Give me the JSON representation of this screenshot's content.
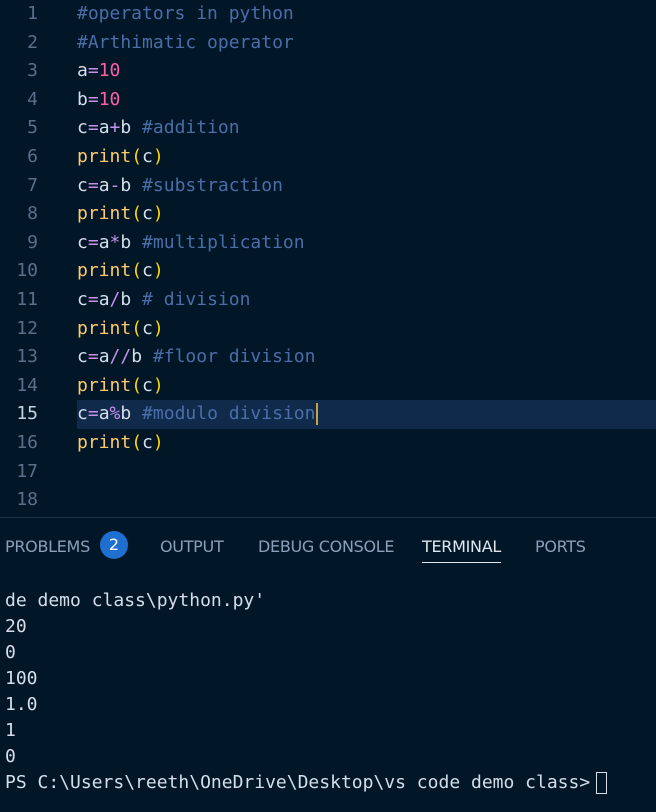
{
  "editor": {
    "lines": [
      {
        "num": "1",
        "tokens": [
          {
            "t": "#operators in python",
            "c": "comment"
          }
        ]
      },
      {
        "num": "2",
        "tokens": [
          {
            "t": "#Arthimatic operator",
            "c": "comment"
          }
        ]
      },
      {
        "num": "3",
        "tokens": [
          {
            "t": "a",
            "c": "var"
          },
          {
            "t": "=",
            "c": "op"
          },
          {
            "t": "10",
            "c": "num2"
          }
        ]
      },
      {
        "num": "4",
        "tokens": [
          {
            "t": "b",
            "c": "var"
          },
          {
            "t": "=",
            "c": "op"
          },
          {
            "t": "10",
            "c": "num2"
          }
        ]
      },
      {
        "num": "5",
        "tokens": [
          {
            "t": "c",
            "c": "var"
          },
          {
            "t": "=",
            "c": "op"
          },
          {
            "t": "a",
            "c": "var"
          },
          {
            "t": "+",
            "c": "op"
          },
          {
            "t": "b",
            "c": "var"
          },
          {
            "t": " #addition",
            "c": "comment"
          }
        ]
      },
      {
        "num": "6",
        "tokens": [
          {
            "t": "print",
            "c": "fn"
          },
          {
            "t": "(",
            "c": "paren"
          },
          {
            "t": "c",
            "c": "var"
          },
          {
            "t": ")",
            "c": "paren"
          }
        ]
      },
      {
        "num": "7",
        "tokens": [
          {
            "t": "c",
            "c": "var"
          },
          {
            "t": "=",
            "c": "op"
          },
          {
            "t": "a",
            "c": "var"
          },
          {
            "t": "-",
            "c": "op"
          },
          {
            "t": "b",
            "c": "var"
          },
          {
            "t": " #substraction",
            "c": "comment"
          }
        ]
      },
      {
        "num": "8",
        "tokens": [
          {
            "t": "print",
            "c": "fn"
          },
          {
            "t": "(",
            "c": "paren"
          },
          {
            "t": "c",
            "c": "var"
          },
          {
            "t": ")",
            "c": "paren"
          }
        ]
      },
      {
        "num": "9",
        "tokens": [
          {
            "t": "c",
            "c": "var"
          },
          {
            "t": "=",
            "c": "op"
          },
          {
            "t": "a",
            "c": "var"
          },
          {
            "t": "*",
            "c": "op"
          },
          {
            "t": "b",
            "c": "var"
          },
          {
            "t": " #multiplication",
            "c": "comment"
          }
        ]
      },
      {
        "num": "10",
        "tokens": [
          {
            "t": "print",
            "c": "fn"
          },
          {
            "t": "(",
            "c": "paren"
          },
          {
            "t": "c",
            "c": "var"
          },
          {
            "t": ")",
            "c": "paren"
          }
        ]
      },
      {
        "num": "11",
        "tokens": [
          {
            "t": "c",
            "c": "var"
          },
          {
            "t": "=",
            "c": "op"
          },
          {
            "t": "a",
            "c": "var"
          },
          {
            "t": "/",
            "c": "op"
          },
          {
            "t": "b",
            "c": "var"
          },
          {
            "t": " # division",
            "c": "comment"
          }
        ]
      },
      {
        "num": "12",
        "tokens": [
          {
            "t": "print",
            "c": "fn"
          },
          {
            "t": "(",
            "c": "paren"
          },
          {
            "t": "c",
            "c": "var"
          },
          {
            "t": ")",
            "c": "paren"
          }
        ]
      },
      {
        "num": "13",
        "tokens": [
          {
            "t": "c",
            "c": "var"
          },
          {
            "t": "=",
            "c": "op"
          },
          {
            "t": "a",
            "c": "var"
          },
          {
            "t": "//",
            "c": "op"
          },
          {
            "t": "b",
            "c": "var"
          },
          {
            "t": " #floor division",
            "c": "comment"
          }
        ]
      },
      {
        "num": "14",
        "tokens": [
          {
            "t": "print",
            "c": "fn"
          },
          {
            "t": "(",
            "c": "paren"
          },
          {
            "t": "c",
            "c": "var"
          },
          {
            "t": ")",
            "c": "paren"
          }
        ]
      },
      {
        "num": "15",
        "current": true,
        "tokens": [
          {
            "t": "c",
            "c": "var"
          },
          {
            "t": "=",
            "c": "op"
          },
          {
            "t": "a",
            "c": "var"
          },
          {
            "t": "%",
            "c": "op"
          },
          {
            "t": "b",
            "c": "var"
          },
          {
            "t": " #modulo division",
            "c": "comment"
          }
        ]
      },
      {
        "num": "16",
        "tokens": [
          {
            "t": "print",
            "c": "fn"
          },
          {
            "t": "(",
            "c": "paren"
          },
          {
            "t": "c",
            "c": "var"
          },
          {
            "t": ")",
            "c": "paren"
          }
        ]
      },
      {
        "num": "17",
        "tokens": []
      },
      {
        "num": "18",
        "tokens": []
      }
    ]
  },
  "panel": {
    "tabs": {
      "problems": "PROBLEMS",
      "problems_count": "2",
      "output": "OUTPUT",
      "debug_console": "DEBUG CONSOLE",
      "terminal": "TERMINAL",
      "ports": "PORTS"
    },
    "active_tab": "TERMINAL",
    "terminal_lines": [
      "de demo class\\python.py'",
      "20",
      "0",
      "100",
      "1.0",
      "1",
      "0"
    ],
    "prompt": "PS C:\\Users\\reeth\\OneDrive\\Desktop\\vs code demo class> "
  },
  "colors": {
    "background": "#011627",
    "comment": "#4a6ea8",
    "keyword_fn": "#ffcb6b",
    "number": "#ff5fa8",
    "badge": "#1f6fd1"
  }
}
